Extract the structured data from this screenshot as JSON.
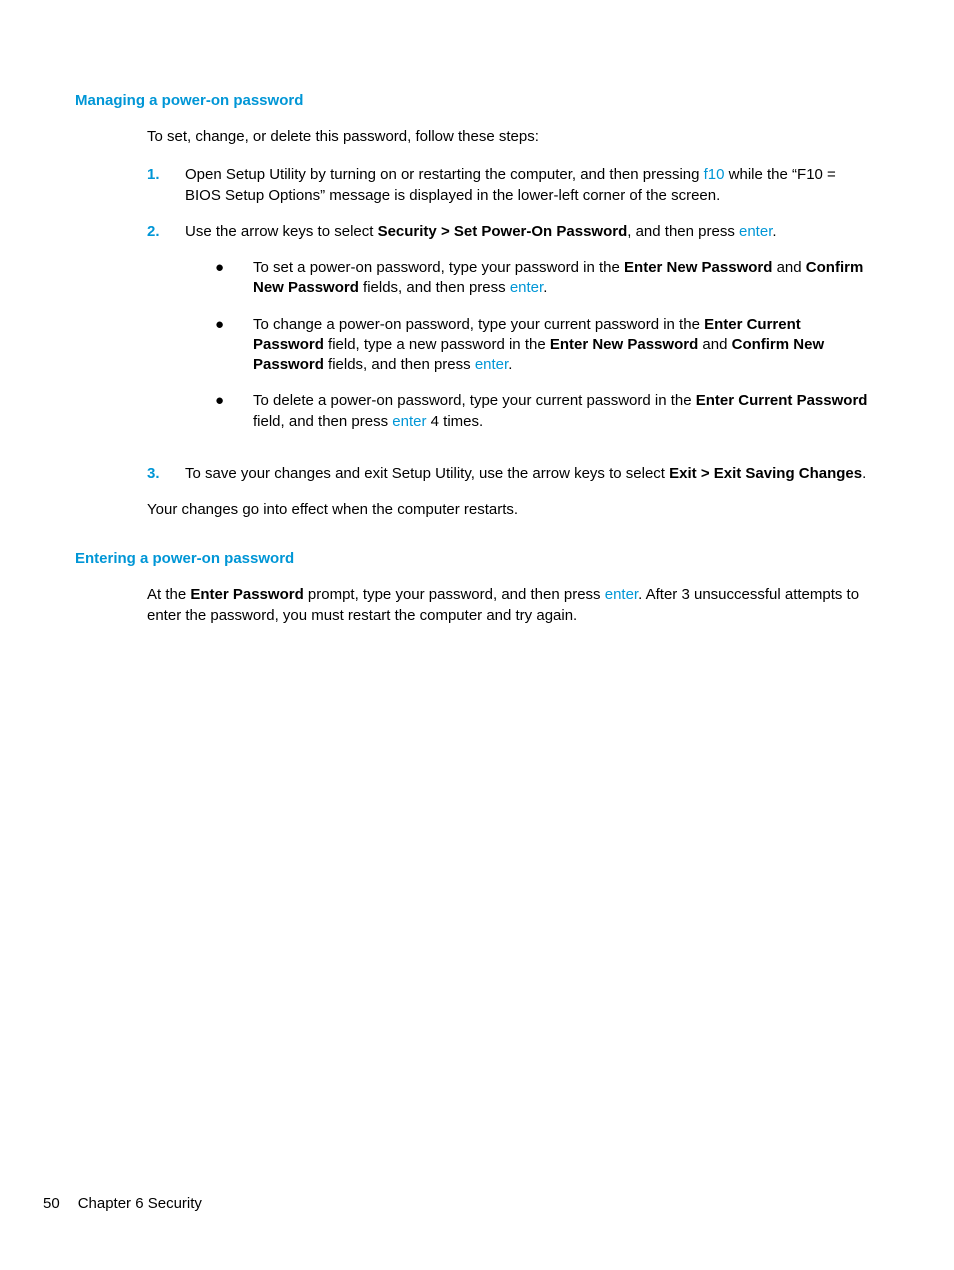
{
  "section1": {
    "heading": "Managing a power-on password",
    "intro": "To set, change, or delete this password, follow these steps:",
    "steps": {
      "s1": {
        "num": "1.",
        "t1": "Open Setup Utility by turning on or restarting the computer, and then pressing ",
        "k1": "f10",
        "t2": " while the “F10 = BIOS Setup Options” message is displayed in the lower-left corner of the screen."
      },
      "s2": {
        "num": "2.",
        "t1": "Use the arrow keys to select ",
        "b1": "Security > Set Power-On Password",
        "t2": ", and then press ",
        "k1": "enter",
        "t3": ".",
        "sub": {
          "a": {
            "t1": "To set a power-on password, type your password in the ",
            "b1": "Enter New Password",
            "t2": " and ",
            "b2": "Confirm New Password",
            "t3": " fields, and then press ",
            "k1": "enter",
            "t4": "."
          },
          "b": {
            "t1": "To change a power-on password, type your current password in the ",
            "b1": "Enter Current Password",
            "t2": " field, type a new password in the ",
            "b2": "Enter New Password",
            "t3": " and ",
            "b3": "Confirm New Password",
            "t4": " fields, and then press ",
            "k1": "enter",
            "t5": "."
          },
          "c": {
            "t1": "To delete a power-on password, type your current password in the ",
            "b1": "Enter Current Password",
            "t2": " field, and then press ",
            "k1": "enter",
            "t3": " 4 times."
          }
        }
      },
      "s3": {
        "num": "3.",
        "t1": "To save your changes and exit Setup Utility, use the arrow keys to select ",
        "b1": "Exit > Exit Saving Changes",
        "t2": "."
      }
    },
    "closing": "Your changes go into effect when the computer restarts."
  },
  "section2": {
    "heading": "Entering a power-on password",
    "para": {
      "t1": "At the ",
      "b1": "Enter Password",
      "t2": " prompt, type your password, and then press ",
      "k1": "enter",
      "t3": ". After 3 unsuccessful attempts to enter the password, you must restart the computer and try again."
    }
  },
  "footer": {
    "pagenum": "50",
    "chapter": "Chapter 6   Security"
  },
  "bullet": "●"
}
